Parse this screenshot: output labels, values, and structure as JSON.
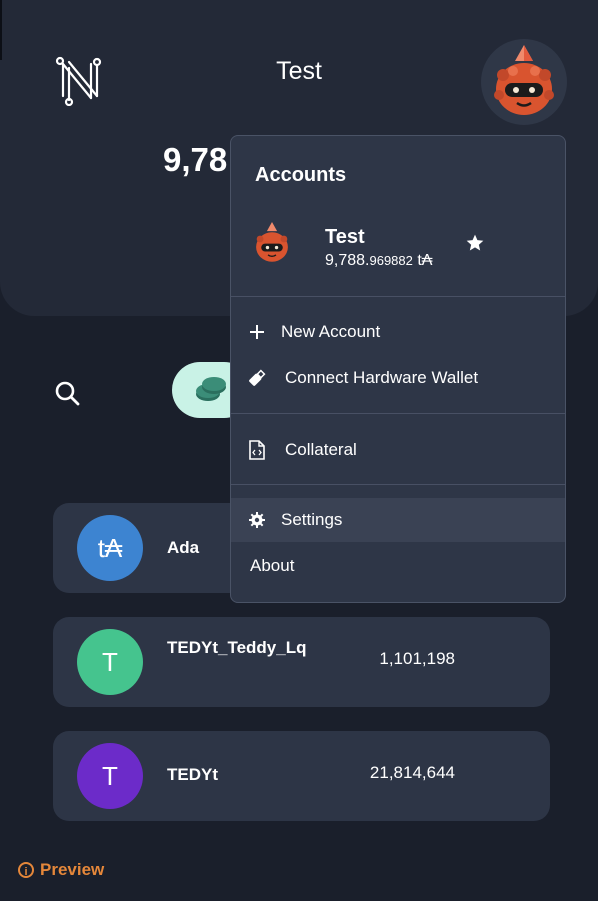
{
  "header": {
    "title": "Test",
    "balance_partial": "9,78"
  },
  "assets": [
    {
      "name": "Ada",
      "symbol": "t₳",
      "amount": "",
      "color": "#3d84d1"
    },
    {
      "name": "TEDYt_Teddy_Lq",
      "symbol": "T",
      "amount": "1,101,198",
      "color": "#45c48e"
    },
    {
      "name": "TEDYt",
      "symbol": "T",
      "amount": "21,814,644",
      "color": "#6c2bc9"
    }
  ],
  "account_menu": {
    "title": "Accounts",
    "account": {
      "name": "Test",
      "balance_main": "9,788.",
      "balance_decimals": "969882",
      "currency": "t₳"
    },
    "items": {
      "new_account": "New Account",
      "connect_hw": "Connect Hardware Wallet",
      "collateral": "Collateral",
      "settings": "Settings",
      "about": "About"
    }
  },
  "footer": {
    "preview": "Preview",
    "info_icon": "i"
  },
  "colors": {
    "background": "#1a1f2b",
    "card": "#2d3546",
    "menu": "#2e3647",
    "accent_preview": "#e5873a",
    "pill": "#c9f2e6"
  },
  "icons": [
    "nami-logo-icon",
    "robot-avatar-icon",
    "search-icon",
    "coins-icon",
    "star-icon",
    "plus-icon",
    "usb-icon",
    "file-code-icon",
    "gear-icon",
    "info-icon"
  ]
}
